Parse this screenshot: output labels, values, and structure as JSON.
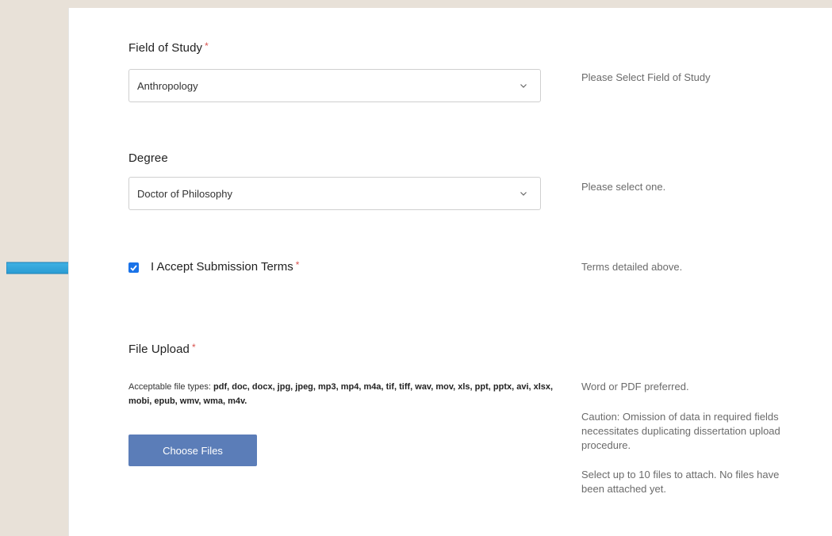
{
  "fields": {
    "field_of_study": {
      "label": "Field of Study",
      "required_mark": "*",
      "value": "Anthropology",
      "help": "Please Select Field of Study"
    },
    "degree": {
      "label": "Degree",
      "value": "Doctor of Philosophy",
      "help": "Please select one."
    },
    "terms": {
      "label": "I Accept Submission Terms",
      "required_mark": "*",
      "checked": true,
      "help": "Terms detailed above."
    },
    "file_upload": {
      "label": "File Upload",
      "required_mark": "*",
      "types_prefix": "Acceptable file types:",
      "types_list": "pdf, doc, docx, jpg, jpeg, mp3, mp4, m4a, tif, tiff, wav, mov, xls, ppt, pptx, avi, xlsx, mobi, epub, wmv, wma, m4v.",
      "button_label": "Choose Files",
      "help_preferred": "Word or PDF preferred.",
      "help_caution": "Caution: Omission of data in required fields necessitates duplicating dissertation upload procedure.",
      "help_attach": "Select up to 10 files to attach. No files have been attached yet."
    }
  },
  "colors": {
    "page_background": "#e8e1d8",
    "panel_background": "#ffffff",
    "required": "#d9534f",
    "checkbox": "#1a73e8",
    "button": "#5b7db8",
    "arrow": "#29a3df"
  },
  "icons": {
    "select_chevron": "chevron-down-icon",
    "checkbox_mark": "checkmark-icon",
    "pointer": "arrow-right-icon"
  }
}
